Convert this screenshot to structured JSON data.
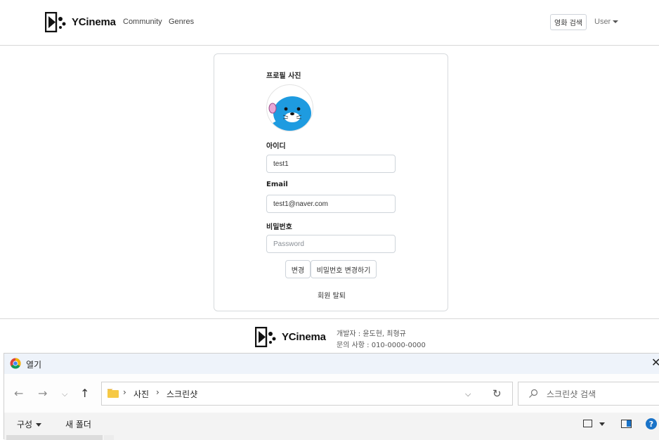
{
  "navbar": {
    "brand": "YCinema",
    "links": [
      "Community",
      "Genres"
    ],
    "search_button": "영화 검색",
    "user_menu": "User"
  },
  "profile": {
    "photo_label": "프로필 사진",
    "id_label": "아이디",
    "id_value": "test1",
    "email_label": "Email",
    "email_value": "test1@naver.com",
    "password_label": "비밀번호",
    "password_placeholder": "Password",
    "change_button": "변경",
    "change_password_button": "비밀번호 변경하기",
    "withdraw_link": "회원 탈퇴"
  },
  "footer": {
    "brand": "YCinema",
    "developers": "개발자 : 윤도현, 최형규",
    "contact": "문의 사항 : 010-0000-0000"
  },
  "dialog": {
    "title": "열기",
    "breadcrumb": [
      "사진",
      "스크린샷"
    ],
    "search_placeholder": "스크린샷 검색",
    "organize": "구성",
    "new_folder": "새 폴더",
    "help": "?"
  }
}
